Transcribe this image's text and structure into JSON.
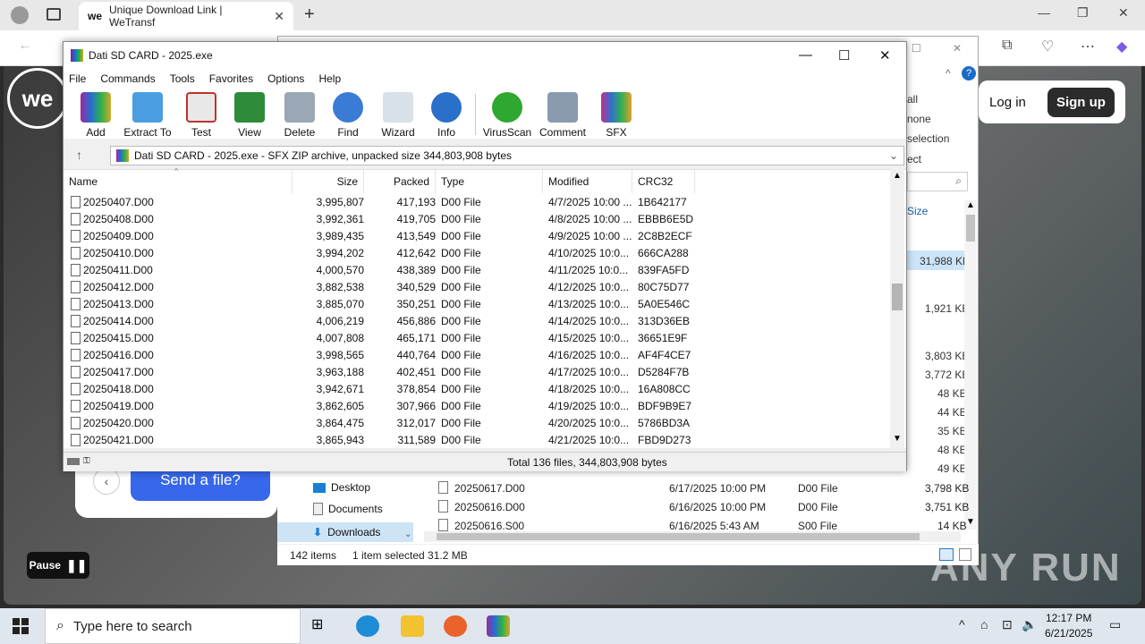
{
  "browser": {
    "tab_title": "Unique Download Link | WeTransf",
    "tab_logo": "we",
    "new_tab": "+",
    "tab_close": "✕"
  },
  "wetransfer": {
    "logo": "we",
    "login": "Log in",
    "signup": "Sign up",
    "send_button": "Send a file?",
    "pause": "Pause"
  },
  "explorer": {
    "side_labels": [
      "all",
      "none",
      "selection",
      "ect"
    ],
    "size_header": "Size",
    "right_sizes": [
      "31,988 KB",
      "1,921 KB",
      "3,803 KB",
      "3,772 KB",
      "48 KB",
      "44 KB",
      "35 KB",
      "48 KB",
      "49 KB",
      "3,798 KB",
      "3,751 KB",
      "14 KB"
    ],
    "nav": [
      "Desktop",
      "Documents",
      "Downloads"
    ],
    "files": [
      {
        "name": "20250617.D00",
        "date": "6/17/2025 10:00 PM",
        "type": "D00 File"
      },
      {
        "name": "20250616.D00",
        "date": "6/16/2025 10:00 PM",
        "type": "D00 File"
      },
      {
        "name": "20250616.S00",
        "date": "6/16/2025 5:43 AM",
        "type": "S00 File"
      }
    ],
    "status_items": "142 items",
    "status_selected": "1 item selected  31.2 MB"
  },
  "winrar": {
    "title": "Dati SD CARD - 2025.exe",
    "menu": [
      "File",
      "Commands",
      "Tools",
      "Favorites",
      "Options",
      "Help"
    ],
    "toolbar": [
      "Add",
      "Extract To",
      "Test",
      "View",
      "Delete",
      "Find",
      "Wizard",
      "Info",
      "VirusScan",
      "Comment",
      "SFX"
    ],
    "path": "Dati SD CARD - 2025.exe - SFX ZIP archive, unpacked size 344,803,908 bytes",
    "columns": [
      "Name",
      "Size",
      "Packed",
      "Type",
      "Modified",
      "CRC32"
    ],
    "rows": [
      [
        "20250407.D00",
        "3,995,807",
        "417,193",
        "D00 File",
        "4/7/2025 10:00 ...",
        "1B642177"
      ],
      [
        "20250408.D00",
        "3,992,361",
        "419,705",
        "D00 File",
        "4/8/2025 10:00 ...",
        "EBBB6E5D"
      ],
      [
        "20250409.D00",
        "3,989,435",
        "413,549",
        "D00 File",
        "4/9/2025 10:00 ...",
        "2C8B2ECF"
      ],
      [
        "20250410.D00",
        "3,994,202",
        "412,642",
        "D00 File",
        "4/10/2025 10:0...",
        "666CA288"
      ],
      [
        "20250411.D00",
        "4,000,570",
        "438,389",
        "D00 File",
        "4/11/2025 10:0...",
        "839FA5FD"
      ],
      [
        "20250412.D00",
        "3,882,538",
        "340,529",
        "D00 File",
        "4/12/2025 10:0...",
        "80C75D77"
      ],
      [
        "20250413.D00",
        "3,885,070",
        "350,251",
        "D00 File",
        "4/13/2025 10:0...",
        "5A0E546C"
      ],
      [
        "20250414.D00",
        "4,006,219",
        "456,886",
        "D00 File",
        "4/14/2025 10:0...",
        "313D36EB"
      ],
      [
        "20250415.D00",
        "4,007,808",
        "465,171",
        "D00 File",
        "4/15/2025 10:0...",
        "36651E9F"
      ],
      [
        "20250416.D00",
        "3,998,565",
        "440,764",
        "D00 File",
        "4/16/2025 10:0...",
        "AF4F4CE7"
      ],
      [
        "20250417.D00",
        "3,963,188",
        "402,451",
        "D00 File",
        "4/17/2025 10:0...",
        "D5284F7B"
      ],
      [
        "20250418.D00",
        "3,942,671",
        "378,854",
        "D00 File",
        "4/18/2025 10:0...",
        "16A808CC"
      ],
      [
        "20250419.D00",
        "3,862,605",
        "307,966",
        "D00 File",
        "4/19/2025 10:0...",
        "BDF9B9E7"
      ],
      [
        "20250420.D00",
        "3,864,475",
        "312,017",
        "D00 File",
        "4/20/2025 10:0...",
        "5786BD3A"
      ],
      [
        "20250421.D00",
        "3,865,943",
        "311,589",
        "D00 File",
        "4/21/2025 10:0...",
        "FBD9D273"
      ]
    ],
    "status": "Total 136 files, 344,803,908 bytes"
  },
  "taskbar": {
    "search_placeholder": "Type here to search",
    "time": "12:17 PM",
    "date": "6/21/2025"
  },
  "watermark": "ANY RUN"
}
